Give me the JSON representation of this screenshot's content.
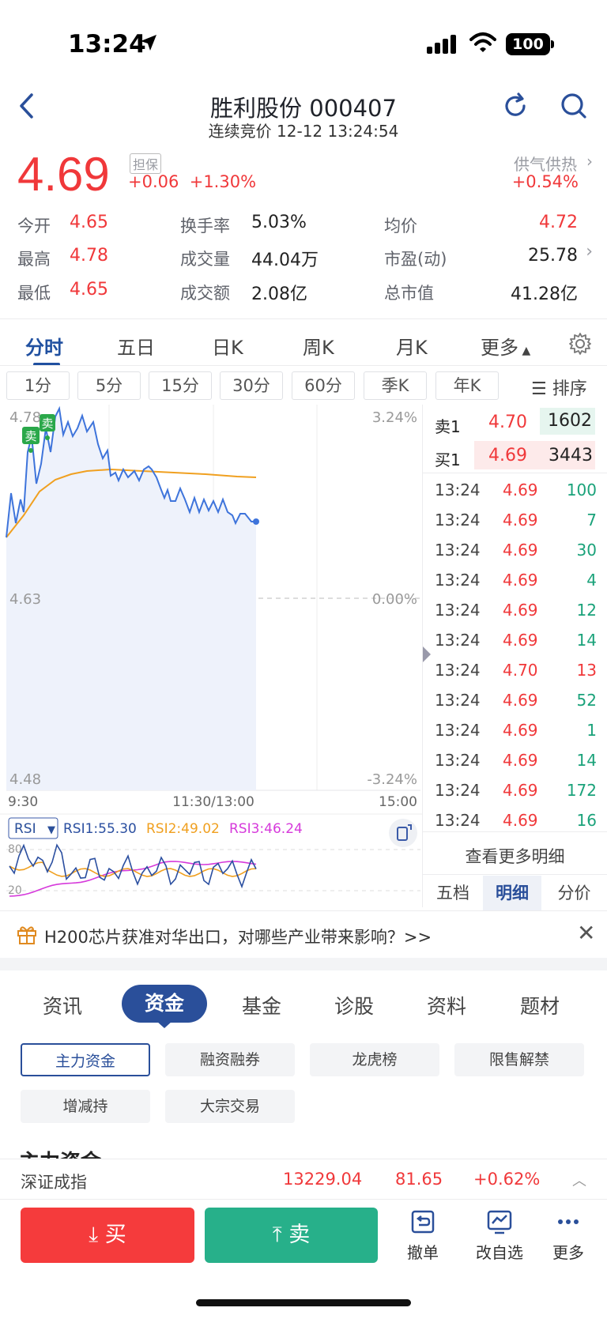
{
  "status": {
    "time": "13:24",
    "battery": "100"
  },
  "header": {
    "title": "胜利股份 000407",
    "subtitle": "连续竞价 12-12 13:24:54"
  },
  "quote": {
    "price": "4.69",
    "tag": "担保",
    "change": "+0.06",
    "change_pct": "+1.30%",
    "sector_name": "供气供热",
    "sector_pct": "+0.54%"
  },
  "stats": [
    {
      "label": "今开",
      "value": "4.65"
    },
    {
      "label": "换手率",
      "value": "5.03%"
    },
    {
      "label": "均价",
      "value": "4.72"
    },
    {
      "label": "最高",
      "value": "4.78"
    },
    {
      "label": "成交量",
      "value": "44.04万"
    },
    {
      "label": "市盈(动)",
      "value": "25.78"
    },
    {
      "label": "最低",
      "value": "4.65"
    },
    {
      "label": "成交额",
      "value": "2.08亿"
    },
    {
      "label": "总市值",
      "value": "41.28亿"
    }
  ],
  "chart_tabs": [
    "分时",
    "五日",
    "日K",
    "周K",
    "月K",
    "更多"
  ],
  "timeframes": [
    "1分",
    "5分",
    "15分",
    "30分",
    "60分",
    "季K",
    "年K"
  ],
  "sort_label": "排序",
  "chart": {
    "y_top": "4.78",
    "y_mid": "4.63",
    "y_bot": "4.48",
    "pct_top": "3.24%",
    "pct_mid": "0.00%",
    "pct_bot": "-3.24%",
    "x_start": "9:30",
    "x_mid": "11:30/13:00",
    "x_end": "15:00",
    "marker_sell": "卖",
    "marker_buy": "卖",
    "marker_buy2": "卖"
  },
  "rsi": {
    "selector": "RSI",
    "rsi1": "RSI1:55.30",
    "rsi2": "RSI2:49.02",
    "rsi3": "RSI3:46.24",
    "level_top": "80",
    "level_bot": "20",
    "color1": "#2b4fa0",
    "color2": "#f0a020",
    "color3": "#d63adb"
  },
  "order_book": {
    "sell1_label": "卖1",
    "sell1_price": "4.70",
    "sell1_vol": "1602",
    "buy1_label": "买1",
    "buy1_price": "4.69",
    "buy1_vol": "3443"
  },
  "ticks": [
    {
      "t": "13:24",
      "p": "4.69",
      "v": "100"
    },
    {
      "t": "13:24",
      "p": "4.69",
      "v": "7"
    },
    {
      "t": "13:24",
      "p": "4.69",
      "v": "30"
    },
    {
      "t": "13:24",
      "p": "4.69",
      "v": "4"
    },
    {
      "t": "13:24",
      "p": "4.69",
      "v": "12"
    },
    {
      "t": "13:24",
      "p": "4.69",
      "v": "14"
    },
    {
      "t": "13:24",
      "p": "4.70",
      "v": "13"
    },
    {
      "t": "13:24",
      "p": "4.69",
      "v": "52"
    },
    {
      "t": "13:24",
      "p": "4.69",
      "v": "1"
    },
    {
      "t": "13:24",
      "p": "4.69",
      "v": "14"
    },
    {
      "t": "13:24",
      "p": "4.69",
      "v": "172"
    },
    {
      "t": "13:24",
      "p": "4.69",
      "v": "16"
    }
  ],
  "more_detail": "查看更多明细",
  "bottom_tabs": [
    "五档",
    "明细",
    "分价"
  ],
  "banner": "H200芯片获准对华出口，对哪些产业带来影响？>>",
  "news_tabs": [
    "资讯",
    "资金",
    "基金",
    "诊股",
    "资料",
    "题材"
  ],
  "chips": [
    "主力资金",
    "融资融券",
    "龙虎榜",
    "限售解禁",
    "增减持",
    "大宗交易"
  ],
  "section_peek": "主力资金",
  "index": {
    "name": "深证成指",
    "value": "13229.04",
    "change": "81.65",
    "pct": "+0.62%"
  },
  "actions": {
    "buy": "买",
    "sell": "卖",
    "cancel": "撤单",
    "edit": "改自选",
    "more": "更多"
  }
}
